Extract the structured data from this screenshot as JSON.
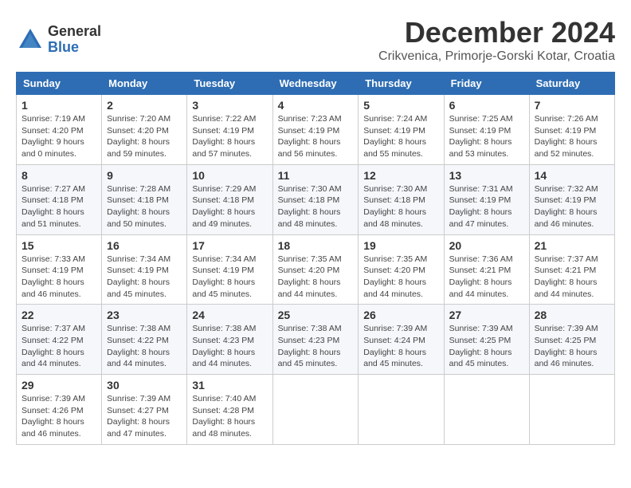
{
  "header": {
    "logo_general": "General",
    "logo_blue": "Blue",
    "month_title": "December 2024",
    "location": "Crikvenica, Primorje-Gorski Kotar, Croatia"
  },
  "calendar": {
    "columns": [
      "Sunday",
      "Monday",
      "Tuesday",
      "Wednesday",
      "Thursday",
      "Friday",
      "Saturday"
    ],
    "weeks": [
      [
        {
          "day": "1",
          "info": "Sunrise: 7:19 AM\nSunset: 4:20 PM\nDaylight: 9 hours\nand 0 minutes."
        },
        {
          "day": "2",
          "info": "Sunrise: 7:20 AM\nSunset: 4:20 PM\nDaylight: 8 hours\nand 59 minutes."
        },
        {
          "day": "3",
          "info": "Sunrise: 7:22 AM\nSunset: 4:19 PM\nDaylight: 8 hours\nand 57 minutes."
        },
        {
          "day": "4",
          "info": "Sunrise: 7:23 AM\nSunset: 4:19 PM\nDaylight: 8 hours\nand 56 minutes."
        },
        {
          "day": "5",
          "info": "Sunrise: 7:24 AM\nSunset: 4:19 PM\nDaylight: 8 hours\nand 55 minutes."
        },
        {
          "day": "6",
          "info": "Sunrise: 7:25 AM\nSunset: 4:19 PM\nDaylight: 8 hours\nand 53 minutes."
        },
        {
          "day": "7",
          "info": "Sunrise: 7:26 AM\nSunset: 4:19 PM\nDaylight: 8 hours\nand 52 minutes."
        }
      ],
      [
        {
          "day": "8",
          "info": "Sunrise: 7:27 AM\nSunset: 4:18 PM\nDaylight: 8 hours\nand 51 minutes."
        },
        {
          "day": "9",
          "info": "Sunrise: 7:28 AM\nSunset: 4:18 PM\nDaylight: 8 hours\nand 50 minutes."
        },
        {
          "day": "10",
          "info": "Sunrise: 7:29 AM\nSunset: 4:18 PM\nDaylight: 8 hours\nand 49 minutes."
        },
        {
          "day": "11",
          "info": "Sunrise: 7:30 AM\nSunset: 4:18 PM\nDaylight: 8 hours\nand 48 minutes."
        },
        {
          "day": "12",
          "info": "Sunrise: 7:30 AM\nSunset: 4:18 PM\nDaylight: 8 hours\nand 48 minutes."
        },
        {
          "day": "13",
          "info": "Sunrise: 7:31 AM\nSunset: 4:19 PM\nDaylight: 8 hours\nand 47 minutes."
        },
        {
          "day": "14",
          "info": "Sunrise: 7:32 AM\nSunset: 4:19 PM\nDaylight: 8 hours\nand 46 minutes."
        }
      ],
      [
        {
          "day": "15",
          "info": "Sunrise: 7:33 AM\nSunset: 4:19 PM\nDaylight: 8 hours\nand 46 minutes."
        },
        {
          "day": "16",
          "info": "Sunrise: 7:34 AM\nSunset: 4:19 PM\nDaylight: 8 hours\nand 45 minutes."
        },
        {
          "day": "17",
          "info": "Sunrise: 7:34 AM\nSunset: 4:19 PM\nDaylight: 8 hours\nand 45 minutes."
        },
        {
          "day": "18",
          "info": "Sunrise: 7:35 AM\nSunset: 4:20 PM\nDaylight: 8 hours\nand 44 minutes."
        },
        {
          "day": "19",
          "info": "Sunrise: 7:35 AM\nSunset: 4:20 PM\nDaylight: 8 hours\nand 44 minutes."
        },
        {
          "day": "20",
          "info": "Sunrise: 7:36 AM\nSunset: 4:21 PM\nDaylight: 8 hours\nand 44 minutes."
        },
        {
          "day": "21",
          "info": "Sunrise: 7:37 AM\nSunset: 4:21 PM\nDaylight: 8 hours\nand 44 minutes."
        }
      ],
      [
        {
          "day": "22",
          "info": "Sunrise: 7:37 AM\nSunset: 4:22 PM\nDaylight: 8 hours\nand 44 minutes."
        },
        {
          "day": "23",
          "info": "Sunrise: 7:38 AM\nSunset: 4:22 PM\nDaylight: 8 hours\nand 44 minutes."
        },
        {
          "day": "24",
          "info": "Sunrise: 7:38 AM\nSunset: 4:23 PM\nDaylight: 8 hours\nand 44 minutes."
        },
        {
          "day": "25",
          "info": "Sunrise: 7:38 AM\nSunset: 4:23 PM\nDaylight: 8 hours\nand 45 minutes."
        },
        {
          "day": "26",
          "info": "Sunrise: 7:39 AM\nSunset: 4:24 PM\nDaylight: 8 hours\nand 45 minutes."
        },
        {
          "day": "27",
          "info": "Sunrise: 7:39 AM\nSunset: 4:25 PM\nDaylight: 8 hours\nand 45 minutes."
        },
        {
          "day": "28",
          "info": "Sunrise: 7:39 AM\nSunset: 4:25 PM\nDaylight: 8 hours\nand 46 minutes."
        }
      ],
      [
        {
          "day": "29",
          "info": "Sunrise: 7:39 AM\nSunset: 4:26 PM\nDaylight: 8 hours\nand 46 minutes."
        },
        {
          "day": "30",
          "info": "Sunrise: 7:39 AM\nSunset: 4:27 PM\nDaylight: 8 hours\nand 47 minutes."
        },
        {
          "day": "31",
          "info": "Sunrise: 7:40 AM\nSunset: 4:28 PM\nDaylight: 8 hours\nand 48 minutes."
        },
        {
          "day": "",
          "info": ""
        },
        {
          "day": "",
          "info": ""
        },
        {
          "day": "",
          "info": ""
        },
        {
          "day": "",
          "info": ""
        }
      ]
    ]
  }
}
